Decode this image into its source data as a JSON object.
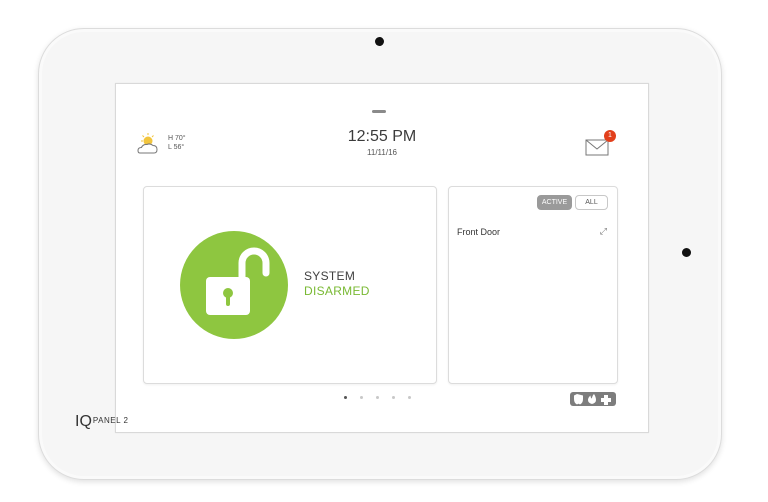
{
  "header": {
    "weather": {
      "high": "H 70°",
      "low": "L 56°",
      "icon": "partly-cloudy-icon"
    },
    "clock": {
      "time": "12:55 PM",
      "date": "11/11/16"
    },
    "messages": {
      "icon": "envelope-icon",
      "unread_count": "1"
    }
  },
  "security_card": {
    "status_line1": "SYSTEM",
    "status_line2": "DISARMED",
    "icon": "unlocked-padlock-icon",
    "accent_color": "#8ec640"
  },
  "sensor_card": {
    "filter_active_label": "ACTIVE",
    "filter_all_label": "ALL",
    "sensors": [
      {
        "name": "Front Door",
        "icon": "open-arrows-icon"
      }
    ]
  },
  "pagination": {
    "page_count": 5,
    "current_page": 1
  },
  "emergency_button": {
    "icons": [
      "shield-icon",
      "fire-icon",
      "medical-cross-icon"
    ]
  },
  "device": {
    "brand_main": "IQ",
    "brand_sub": "PANEL 2"
  }
}
